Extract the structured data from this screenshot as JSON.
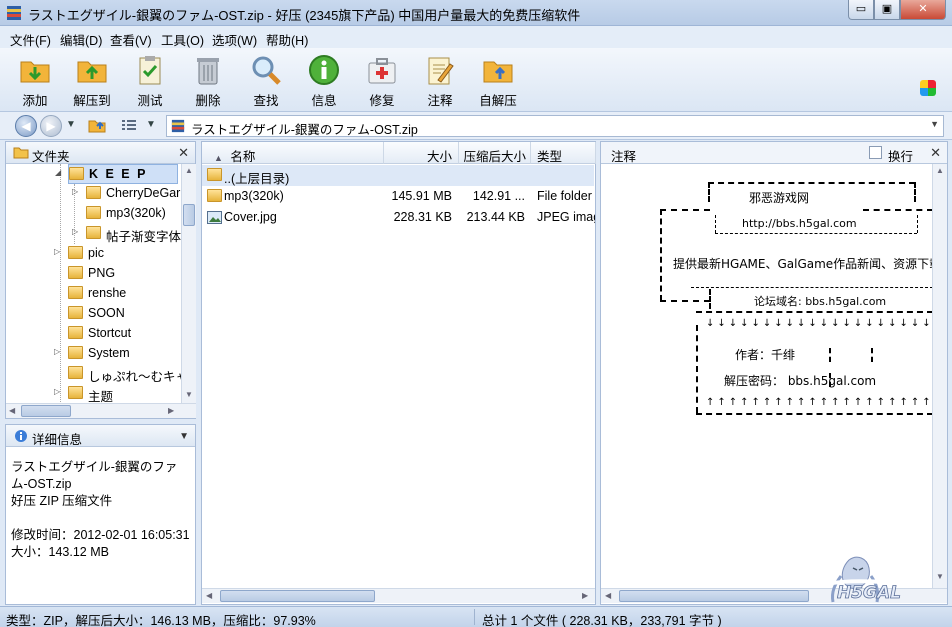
{
  "window": {
    "title": "ラストエグザイル-銀翼のファム-OST.zip - 好压 (2345旗下产品) 中国用户量最大的免费压缩软件",
    "min_symbol": "▭",
    "max_symbol": "▣",
    "close_symbol": "✕"
  },
  "menu": [
    "文件(F)",
    "编辑(D)",
    "查看(V)",
    "工具(O)",
    "选项(W)",
    "帮助(H)"
  ],
  "toolbar": [
    {
      "label": "添加",
      "icon": "add-folder-icon"
    },
    {
      "label": "解压到",
      "icon": "extract-folder-icon"
    },
    {
      "label": "测试",
      "icon": "test-clipboard-icon"
    },
    {
      "label": "删除",
      "icon": "trash-icon"
    },
    {
      "label": "查找",
      "icon": "magnifier-icon"
    },
    {
      "label": "信息",
      "icon": "info-icon"
    },
    {
      "label": "修复",
      "icon": "first-aid-kit-icon"
    },
    {
      "label": "注释",
      "icon": "note-pencil-icon"
    },
    {
      "label": "自解压",
      "icon": "self-extract-icon"
    }
  ],
  "address": {
    "path": "ラストエグザイル-銀翼のファム-OST.zip"
  },
  "folder_panel": {
    "title": "文件夹",
    "tree": [
      {
        "label": "K E E P",
        "bold": true
      },
      {
        "label": "CherryDeGar"
      },
      {
        "label": "mp3(320k)"
      },
      {
        "label": "帖子渐变字体"
      },
      {
        "label": "pic"
      },
      {
        "label": "PNG"
      },
      {
        "label": "renshe"
      },
      {
        "label": "SOON"
      },
      {
        "label": "Stortcut"
      },
      {
        "label": "System"
      },
      {
        "label": "しゅぷれ～むキャ"
      },
      {
        "label": "主题"
      }
    ]
  },
  "details_panel": {
    "title": "详细信息",
    "filename": "ラストエグザイル-銀翼のファム-OST.zip",
    "type": "好压 ZIP 压缩文件",
    "modified": "修改时间：2012-02-01 16:05:31",
    "size": "大小：143.12 MB"
  },
  "file_list": {
    "columns": [
      "名称",
      "大小",
      "压缩后大小",
      "类型"
    ],
    "parent_row": "..(上层目录)",
    "rows": [
      {
        "name": "mp3(320k)",
        "size": "145.91 MB",
        "packed": "142.91 ...",
        "type": "File folder"
      },
      {
        "name": "Cover.jpg",
        "size": "228.31 KB",
        "packed": "213.44 KB",
        "type": "JPEG imag"
      }
    ]
  },
  "comment_panel": {
    "title": "注释",
    "wrap_label": "换行",
    "lines": {
      "site": "邪恶游戏网",
      "url": "http://bbs.h5gal.com",
      "desc": "提供最新HGAME、GalGame作品新闻、资源下载的",
      "domain": "论坛域名: bbs.h5gal.com",
      "arrows_down": "↓↓↓↓↓↓↓↓↓↓↓↓↓↓↓↓↓↓↓↓",
      "author": "作者：千绯",
      "password": "解压密码： bbs.h5gal.com",
      "arrows_up": "↑↑↑↑↑↑↑↑↑↑↑↑↑↑↑↑↑↑↑↑"
    },
    "watermark": "H5GAL"
  },
  "status": {
    "left": "类型：ZIP，解压后大小：146.13 MB，压缩比：97.93%",
    "right": "总计 1 个文件 ( 228.31 KB，233,791 字节 )"
  }
}
